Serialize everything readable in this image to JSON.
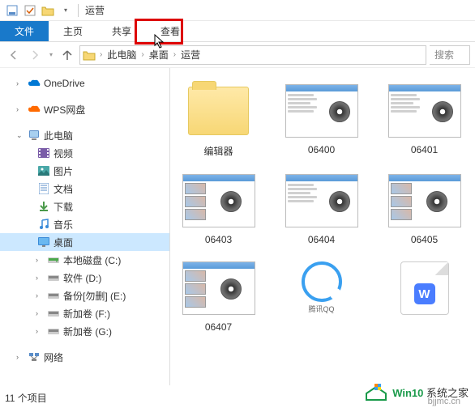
{
  "title": "运营",
  "ribbon": {
    "file": "文件",
    "home": "主页",
    "share": "共享",
    "view": "查看"
  },
  "breadcrumb": {
    "root": "此电脑",
    "desktop": "桌面",
    "current": "运营"
  },
  "search_placeholder": "搜索",
  "sidebar": {
    "onedrive": "OneDrive",
    "wps": "WPS网盘",
    "this_pc": "此电脑",
    "video": "视频",
    "pictures": "图片",
    "documents": "文档",
    "downloads": "下载",
    "music": "音乐",
    "desktop": "桌面",
    "disk_c": "本地磁盘 (C:)",
    "disk_d": "软件 (D:)",
    "disk_e": "备份[勿删] (E:)",
    "disk_f": "新加卷 (F:)",
    "disk_g": "新加卷 (G:)",
    "network": "网络"
  },
  "files": {
    "folder1": "编辑器",
    "vid06400": "06400",
    "vid06401": "06401",
    "vid06403": "06403",
    "vid06404": "06404",
    "vid06405": "06405",
    "vid06407": "06407",
    "qq_label": "腾讯QQ"
  },
  "status": "11 个项目",
  "watermark": {
    "brand": "Win10",
    "text": "系统之家",
    "url": "bjjmc.cn"
  }
}
